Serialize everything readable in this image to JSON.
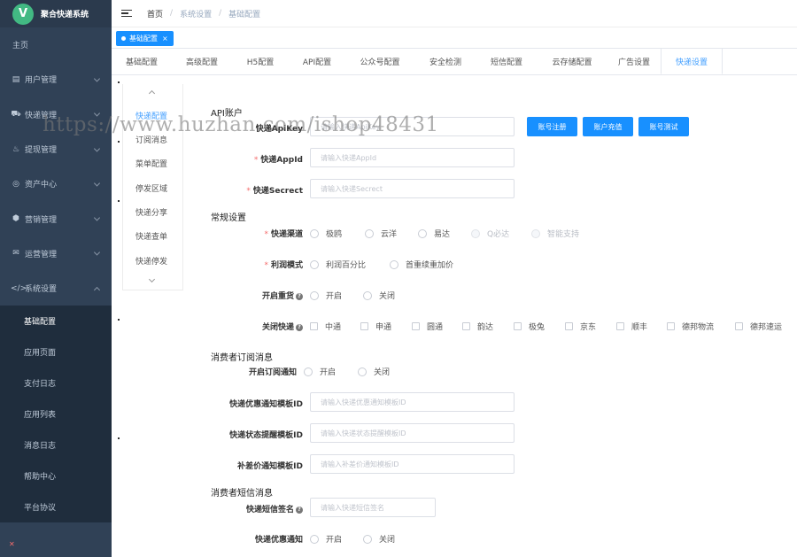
{
  "app": {
    "logo_letter": "V",
    "title": "聚合快递系统"
  },
  "sidebar": {
    "home": "主页",
    "menus": [
      {
        "label": "用户管理",
        "icon": "▤"
      },
      {
        "label": "快递管理",
        "icon": "⛟"
      },
      {
        "label": "提现管理",
        "icon": "♨"
      },
      {
        "label": "资产中心",
        "icon": "◎"
      },
      {
        "label": "营销管理",
        "icon": "⬢"
      },
      {
        "label": "运营管理",
        "icon": "✉"
      },
      {
        "label": "系统设置",
        "icon": "</>"
      }
    ],
    "submenu": [
      "基础配置",
      "应用页面",
      "支付日志",
      "应用列表",
      "消息日志",
      "帮助中心",
      "平台协议"
    ]
  },
  "breadcrumb": {
    "home": "首页",
    "level1": "系统设置",
    "level2": "基础配置"
  },
  "tag": {
    "label": "基础配置",
    "close": "×"
  },
  "top_tabs": [
    "基础配置",
    "高级配置",
    "H5配置",
    "API配置",
    "公众号配置",
    "安全检测",
    "短信配置",
    "云存储配置",
    "广告设置",
    "快递设置"
  ],
  "side_tabs": [
    "快递配置",
    "订阅消息",
    "菜单配置",
    "停发区域",
    "快递分享",
    "快递查单",
    "快递停发"
  ],
  "form": {
    "api_section": "API账户",
    "apikey_label": "快递ApiKey",
    "apikey_placeholder": "请输入快递ApiKey",
    "appid_label": "快递AppId",
    "appid_placeholder": "请输入快递AppId",
    "secret_label": "快递Secrect",
    "secret_placeholder": "请输入快递Secrect",
    "buttons": [
      "账号注册",
      "账户充值",
      "账号测试"
    ],
    "general_section": "常规设置",
    "channel_label": "快递渠道",
    "channels": [
      "极鸥",
      "云洋",
      "易达",
      "Q必达",
      "智能支持"
    ],
    "profit_label": "利润模式",
    "profit_modes": [
      "利润百分比",
      "首重续重加价"
    ],
    "rebook_label": "开启重货",
    "on": "开启",
    "off": "关闭",
    "close_express_label": "关闭快递",
    "express_list": [
      "中通",
      "申通",
      "圆通",
      "韵达",
      "极兔",
      "京东",
      "顺丰",
      "德邦物流",
      "德邦速运"
    ],
    "sub_section": "消费者订阅消息",
    "sub_notify_label": "开启订阅通知",
    "discount_tpl_label": "快递优惠通知模板ID",
    "discount_tpl_placeholder": "请输入快递优惠通知模板ID",
    "status_tpl_label": "快递状态提醒模板ID",
    "status_tpl_placeholder": "请输入快递状态提醒模板ID",
    "diff_tpl_label": "补差价通知模板ID",
    "diff_tpl_placeholder": "请输入补差价通知模板ID",
    "sms_section": "消费者短信消息",
    "sms_sign_label": "快递短信签名",
    "sms_sign_placeholder": "请输入快递短信签名",
    "sms_discount_label": "快递优惠通知"
  },
  "watermark": "https://www.huzhan.com/ishop48431"
}
